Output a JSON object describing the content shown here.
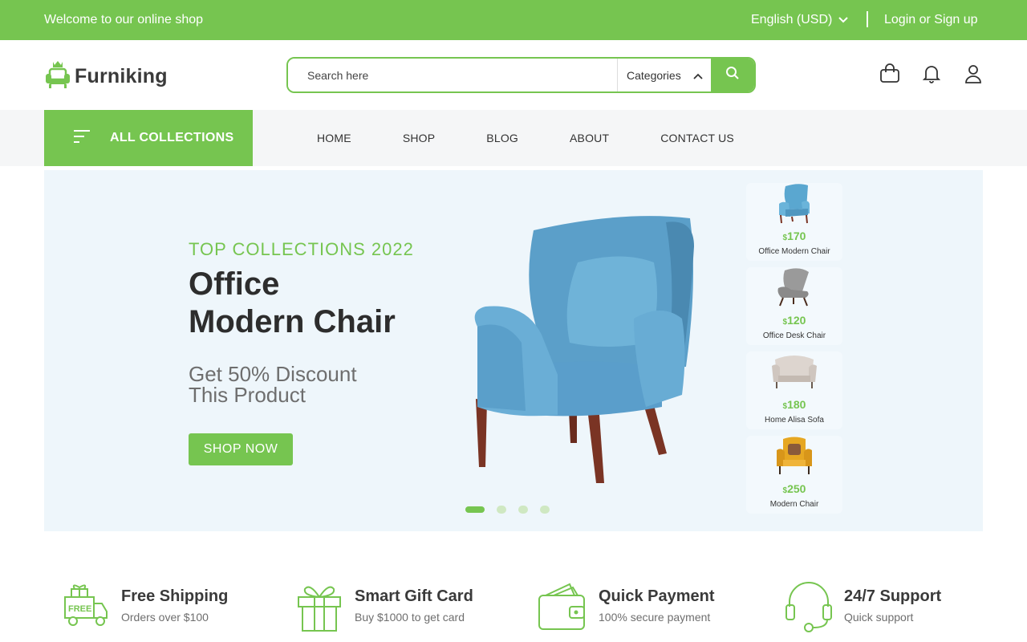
{
  "topbar": {
    "welcome": "Welcome to our online shop",
    "language": "English (USD)",
    "login": "Login or Sign up"
  },
  "header": {
    "logo_text": "Furniking",
    "search_placeholder": "Search here",
    "categories_label": "Categories",
    "icons": [
      "cart-icon",
      "bell-icon",
      "user-icon"
    ]
  },
  "nav": {
    "all_collections": "ALL COLLECTIONS",
    "items": [
      "HOME",
      "SHOP",
      "BLOG",
      "ABOUT",
      "CONTACT US"
    ]
  },
  "hero": {
    "kicker": "TOP COLLECTIONS 2022",
    "title_line1": "Office",
    "title_line2": "Modern Chair",
    "subtitle_line1": "Get 50% Discount",
    "subtitle_line2": "This Product",
    "cta": "SHOP NOW",
    "slide_count": 4,
    "active_slide": 1
  },
  "products": [
    {
      "currency": "$",
      "price": "170",
      "name": "Office Modern Chair",
      "color": "#5aa7d0"
    },
    {
      "currency": "$",
      "price": "120",
      "name": "Office Desk Chair",
      "color": "#8a8a8a"
    },
    {
      "currency": "$",
      "price": "180",
      "name": "Home Alisa Sofa",
      "color": "#cfc6bf"
    },
    {
      "currency": "$",
      "price": "250",
      "name": "Modern Chair",
      "color": "#e6a722"
    }
  ],
  "features": [
    {
      "title": "Free Shipping",
      "subtitle": "Orders over $100",
      "icon": "truck-icon"
    },
    {
      "title": "Smart Gift Card",
      "subtitle": "Buy $1000 to get card",
      "icon": "gift-icon"
    },
    {
      "title": "Quick Payment",
      "subtitle": "100% secure payment",
      "icon": "wallet-icon"
    },
    {
      "title": "24/7 Support",
      "subtitle": "Quick support",
      "icon": "headset-icon"
    }
  ],
  "colors": {
    "brand_green": "#76c550",
    "hero_bg": "#eef6fb",
    "text_dark": "#2d2d2d"
  }
}
